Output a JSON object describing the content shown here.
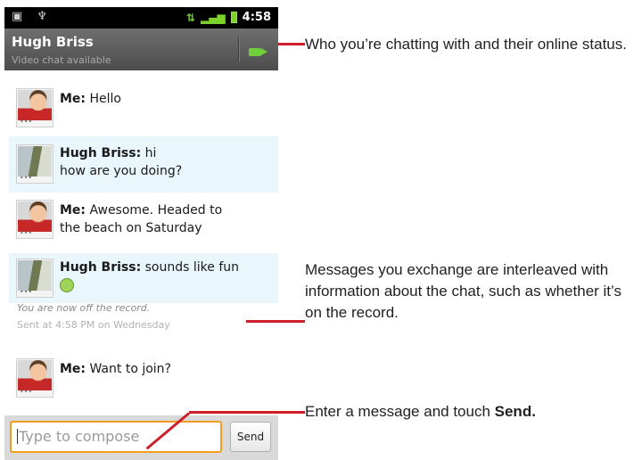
{
  "status_bar": {
    "time": "4:58"
  },
  "chat_header": {
    "contact_name": "Hugh Briss",
    "status": "Video chat available"
  },
  "messages": [
    {
      "sender": "Me:",
      "text": "Hello",
      "highlight": false
    },
    {
      "sender": "Hugh Briss:",
      "text": "hi",
      "text2": "how are you doing?",
      "highlight": true
    },
    {
      "sender": "Me:",
      "text": "Awesome.  Headed to",
      "text2": "the beach on Saturday",
      "highlight": false
    },
    {
      "sender": "Hugh Briss:",
      "text": "sounds like fun",
      "highlight": true
    },
    {
      "sender": "Me:",
      "text": "Want to join?",
      "highlight": false
    }
  ],
  "system_notes": {
    "off_record": "You are now off the record.",
    "sent_at": "Sent at 4:58 PM on Wednesday"
  },
  "compose": {
    "placeholder": "Type to compose",
    "send_label": "Send"
  },
  "callouts": {
    "chat_with": "Who you’re chatting with and their online status.",
    "messages": "Messages you exchange are interleaved with information about the chat, such as whether it’s on the record.",
    "enter_message_prefix": "Enter a message and touch ",
    "enter_message_bold": "Send."
  },
  "colors": {
    "leader_line": "#cc1f2a",
    "video_icon": "#6fd03b",
    "compose_border": "#f39c21",
    "highlight_row": "#e9f6fc"
  }
}
